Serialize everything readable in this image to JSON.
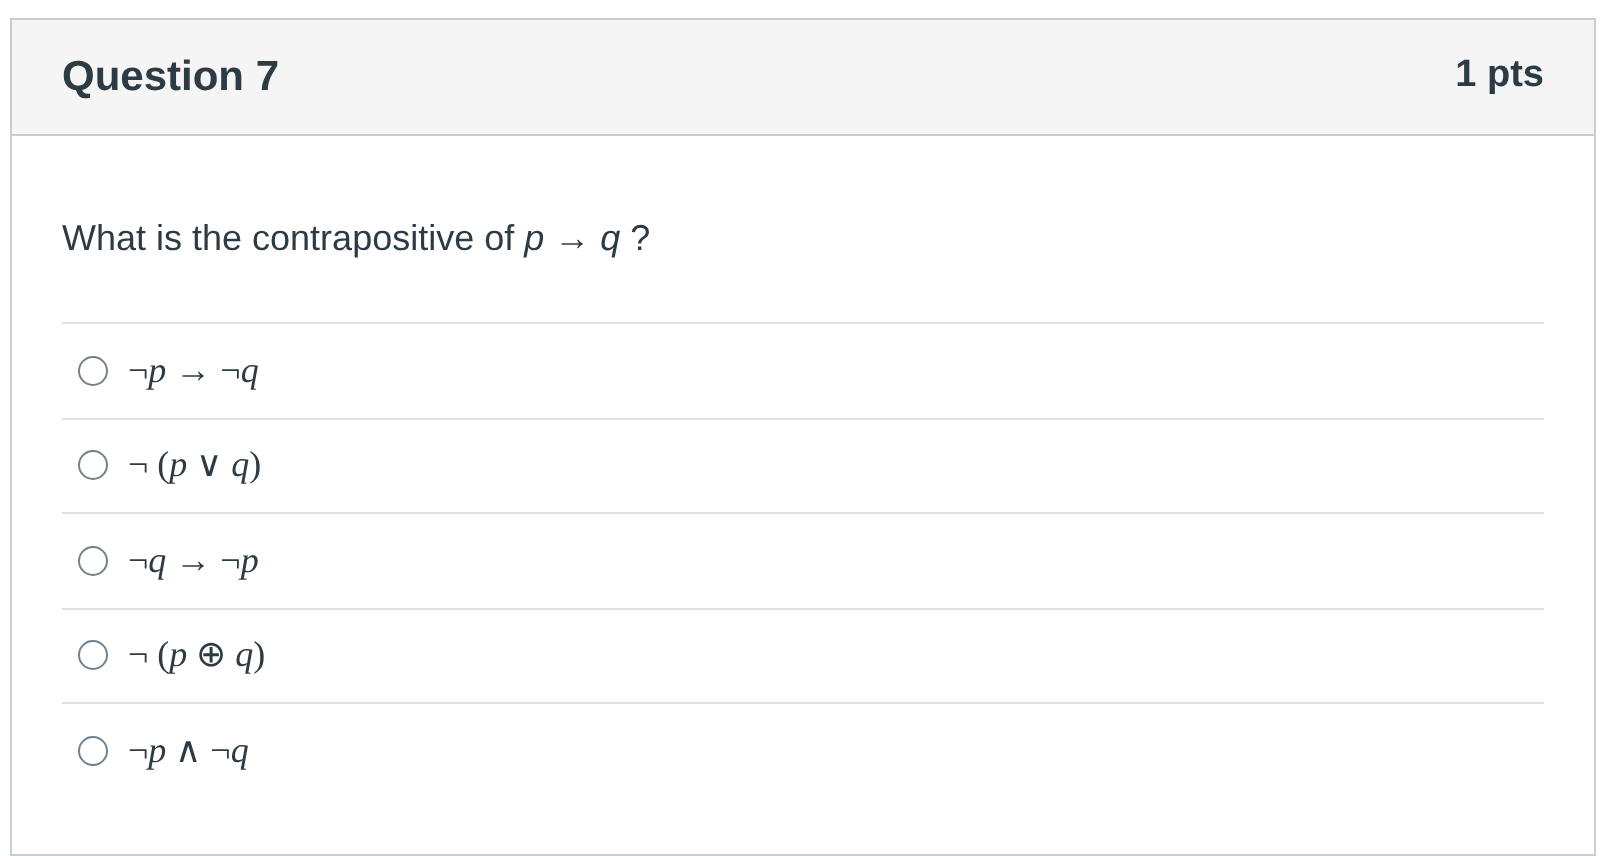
{
  "question": {
    "title": "Question 7",
    "points": "1 pts",
    "text": "What is the contrapositive of *p* → *q* ?"
  },
  "answers": [
    {
      "label": "¬*p* → ¬*q*",
      "selected": false
    },
    {
      "label": "¬ (*p* ∨ *q*)",
      "selected": false
    },
    {
      "label": "¬*q* → ¬*p*",
      "selected": false
    },
    {
      "label": "¬ (*p* ⊕ *q*)",
      "selected": false
    },
    {
      "label": "¬*p* ∧ ¬*q*",
      "selected": false
    }
  ]
}
